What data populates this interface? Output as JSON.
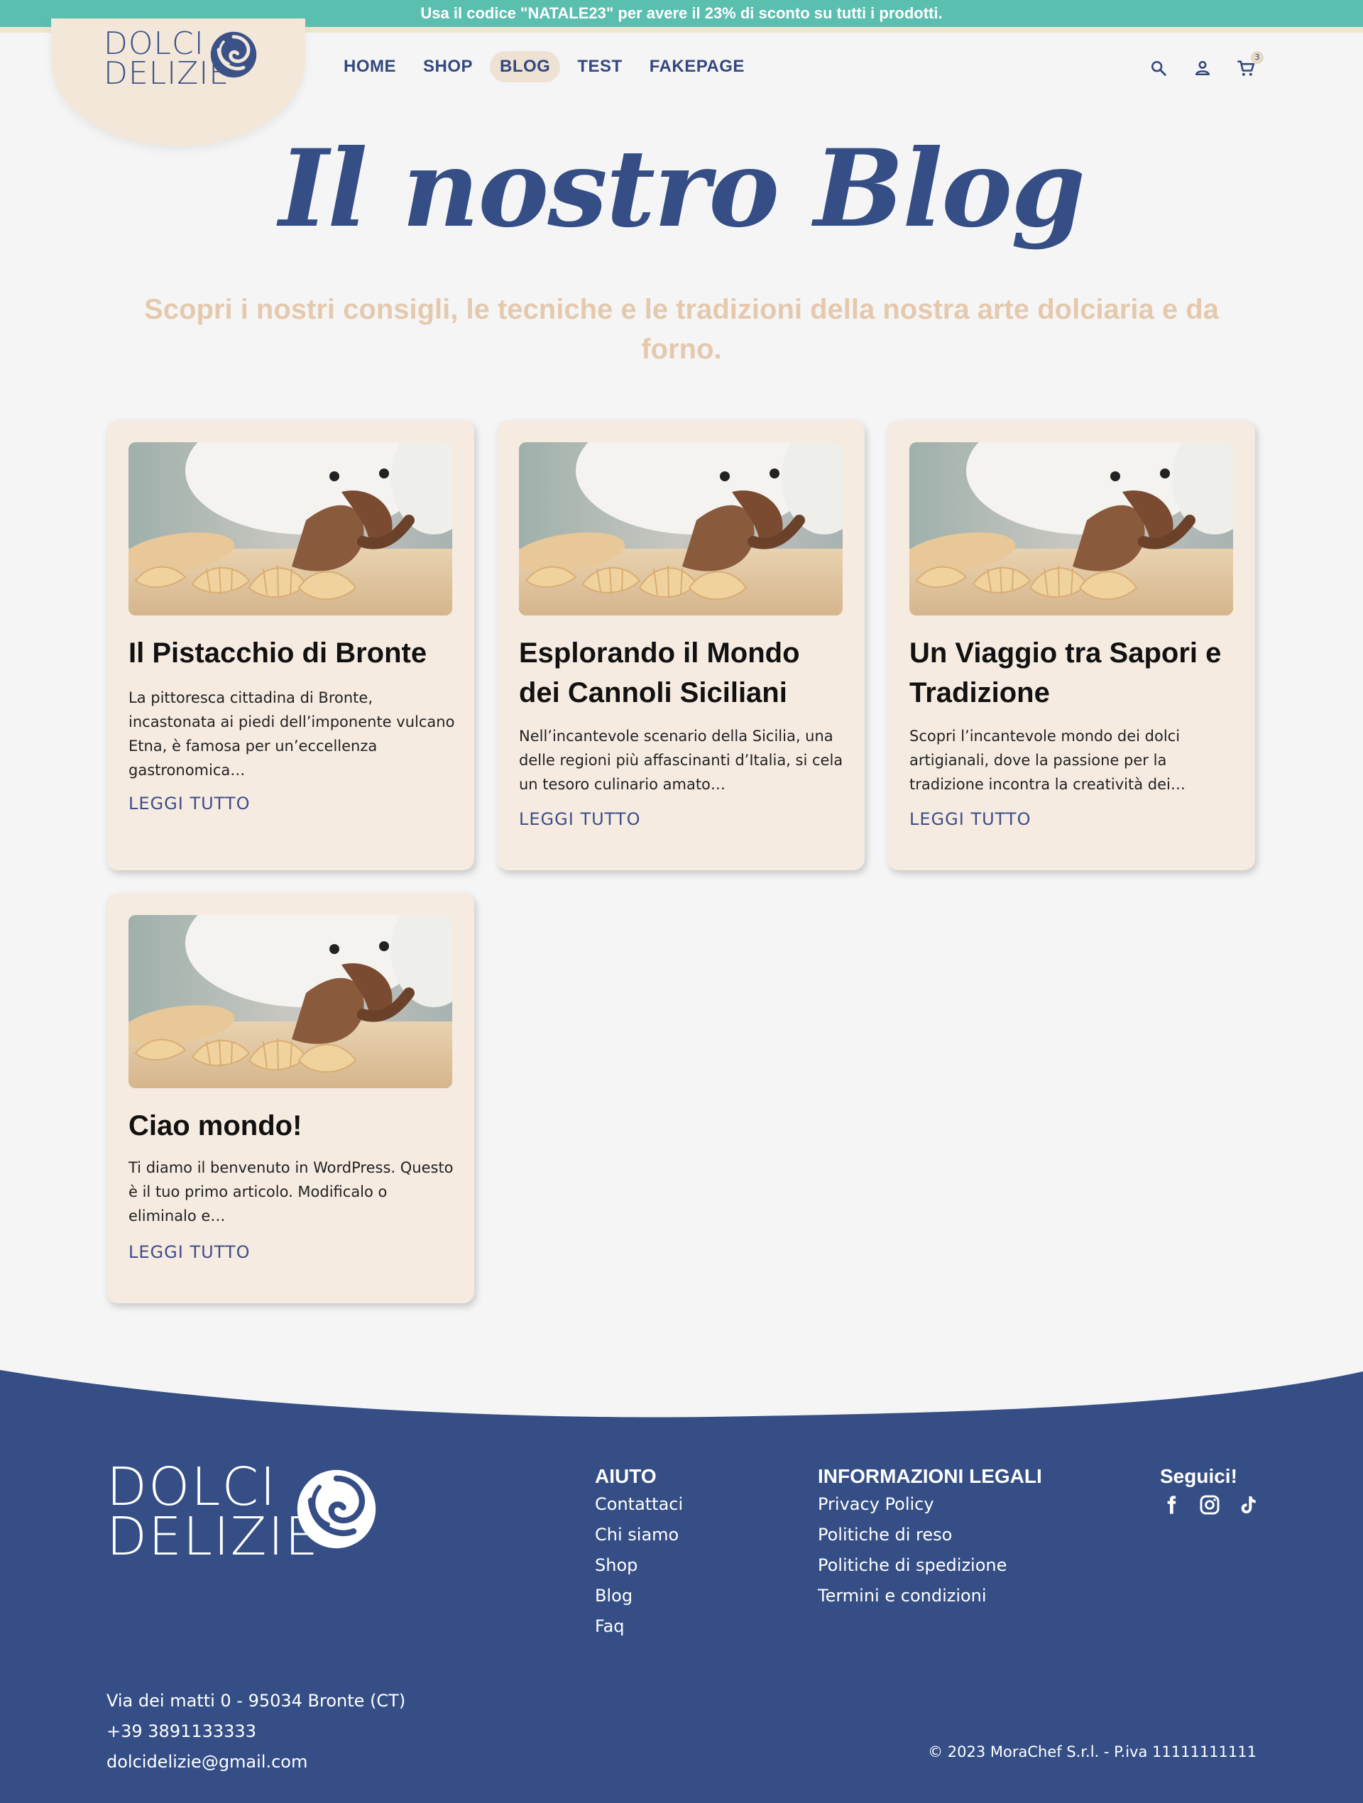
{
  "promo": {
    "text": "Usa il codice \"NATALE23\" per avere il 23% di sconto su tutti i prodotti."
  },
  "logo": {
    "line1": "DOLCI",
    "line2": "DELIZIE"
  },
  "nav": {
    "items": [
      {
        "label": "HOME",
        "active": false
      },
      {
        "label": "SHOP",
        "active": false
      },
      {
        "label": "BLOG",
        "active": true
      },
      {
        "label": "TEST",
        "active": false
      },
      {
        "label": "FAKEPAGE",
        "active": false
      }
    ]
  },
  "header_icons": {
    "search": "search-icon",
    "account": "user-icon",
    "cart": "cart-icon",
    "cart_count": "3"
  },
  "hero": {
    "title": "Il nostro Blog",
    "subtitle": "Scopri i nostri consigli, le tecniche e le tradizioni della nostra arte dolciaria e da forno."
  },
  "posts": [
    {
      "title": "Il Pistacchio di Bronte",
      "excerpt": "La pittoresca cittadina di Bronte, incastonata ai piedi dell’imponente vulcano Etna, è famosa per un’eccellenza gastronomica…",
      "link": "LEGGI TUTTO"
    },
    {
      "title": "Esplorando il Mondo dei Cannoli Siciliani",
      "excerpt": "Nell’incantevole scenario della Sicilia, una delle regioni più affascinanti d’Italia, si cela un tesoro culinario amato…",
      "link": "LEGGI TUTTO"
    },
    {
      "title": "Un Viaggio tra Sapori e Tradizione",
      "excerpt": "Scopri l’incantevole mondo dei dolci artigianali, dove la passione per la tradizione incontra la creatività dei…",
      "link": "LEGGI TUTTO"
    },
    {
      "title": "Ciao mondo!",
      "excerpt": "Ti diamo il benvenuto in WordPress. Questo è il tuo primo articolo. Modificalo o eliminalo e…",
      "link": "LEGGI TUTTO"
    }
  ],
  "footer": {
    "help": {
      "heading": "AIUTO",
      "links": [
        "Contattaci",
        "Chi siamo",
        "Shop",
        "Blog",
        "Faq"
      ]
    },
    "legal": {
      "heading": "INFORMAZIONI LEGALI",
      "links": [
        "Privacy Policy",
        "Politiche di reso",
        "Politiche di spedizione",
        "Termini e condizioni"
      ]
    },
    "social": {
      "heading": "Seguici!",
      "icons": [
        "facebook-icon",
        "instagram-icon",
        "tiktok-icon"
      ]
    },
    "contact": {
      "address": "Via dei matti 0 - 95034 Bronte (CT)",
      "phone": "+39 3891133333",
      "email": "dolcidelizie@gmail.com"
    },
    "copyright": "© 2023 MoraChef S.r.l. - P.iva 11111111111"
  },
  "colors": {
    "brand_blue": "#354f86",
    "promo_teal": "#5bbfb0",
    "beige": "#f5ebe0",
    "subtitle_tan": "#e5c9ad"
  }
}
